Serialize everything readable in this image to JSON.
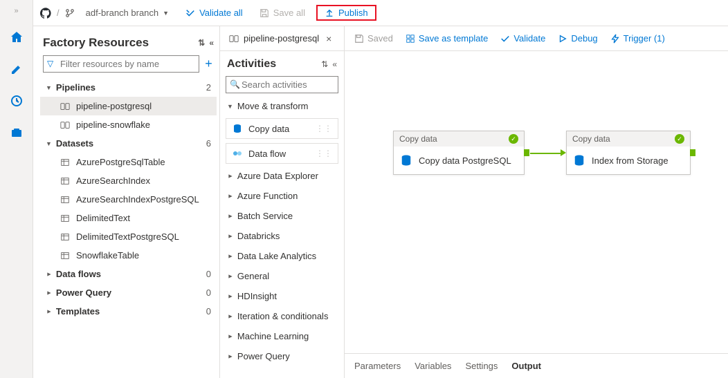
{
  "topbar": {
    "branch_label": "adf-branch branch",
    "validate_all": "Validate all",
    "save_all": "Save all",
    "publish": "Publish"
  },
  "resources": {
    "title": "Factory Resources",
    "filter_placeholder": "Filter resources by name",
    "sections": {
      "pipelines": {
        "label": "Pipelines",
        "count": "2"
      },
      "datasets": {
        "label": "Datasets",
        "count": "6"
      },
      "dataflows": {
        "label": "Data flows",
        "count": "0"
      },
      "powerquery": {
        "label": "Power Query",
        "count": "0"
      },
      "templates": {
        "label": "Templates",
        "count": "0"
      }
    },
    "pipelines": [
      {
        "name": "pipeline-postgresql"
      },
      {
        "name": "pipeline-snowflake"
      }
    ],
    "datasets": [
      {
        "name": "AzurePostgreSqlTable"
      },
      {
        "name": "AzureSearchIndex"
      },
      {
        "name": "AzureSearchIndexPostgreSQL"
      },
      {
        "name": "DelimitedText"
      },
      {
        "name": "DelimitedTextPostgreSQL"
      },
      {
        "name": "SnowflakeTable"
      }
    ]
  },
  "tab": {
    "title": "pipeline-postgresql"
  },
  "activities": {
    "title": "Activities",
    "search_placeholder": "Search activities",
    "groups": {
      "move": "Move & transform",
      "copy_data": "Copy data",
      "data_flow": "Data flow",
      "ade": "Azure Data Explorer",
      "af": "Azure Function",
      "batch": "Batch Service",
      "databricks": "Databricks",
      "dla": "Data Lake Analytics",
      "general": "General",
      "hdi": "HDInsight",
      "iter": "Iteration & conditionals",
      "ml": "Machine Learning",
      "pq": "Power Query"
    }
  },
  "canvas_toolbar": {
    "saved": "Saved",
    "save_as_template": "Save as template",
    "validate": "Validate",
    "debug": "Debug",
    "trigger": "Trigger (1)"
  },
  "nodes": {
    "n1": {
      "type": "Copy data",
      "title": "Copy data PostgreSQL"
    },
    "n2": {
      "type": "Copy data",
      "title": "Index from Storage"
    }
  },
  "bottom_tabs": {
    "parameters": "Parameters",
    "variables": "Variables",
    "settings": "Settings",
    "output": "Output"
  }
}
